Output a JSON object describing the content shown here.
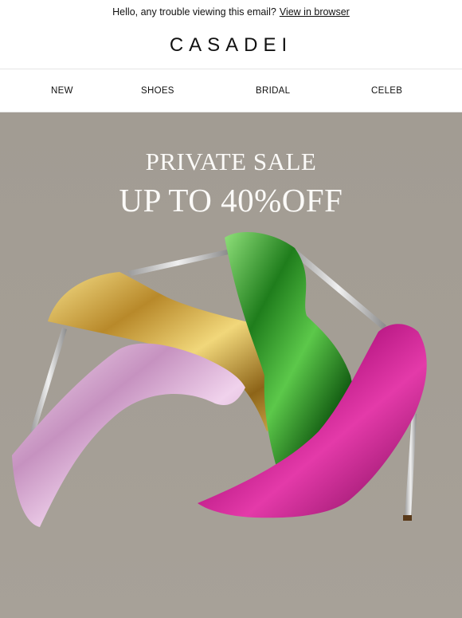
{
  "preheader": {
    "text": "Hello, any trouble viewing this email?",
    "link_label": "View in browser"
  },
  "brand": {
    "logo_text": "CASADEI"
  },
  "nav": {
    "items": [
      {
        "label": "NEW"
      },
      {
        "label": "SHOES"
      },
      {
        "label": "BRIDAL"
      },
      {
        "label": "CELEB"
      }
    ]
  },
  "hero": {
    "kicker": "PRIVATE SALE",
    "headline": "UP TO 40%OFF",
    "image_description_colors": {
      "background": "#a39d94",
      "gold": "#c9a13b",
      "pink": "#d9a9d3",
      "green": "#2f9a2a",
      "magenta": "#c4188f"
    }
  }
}
